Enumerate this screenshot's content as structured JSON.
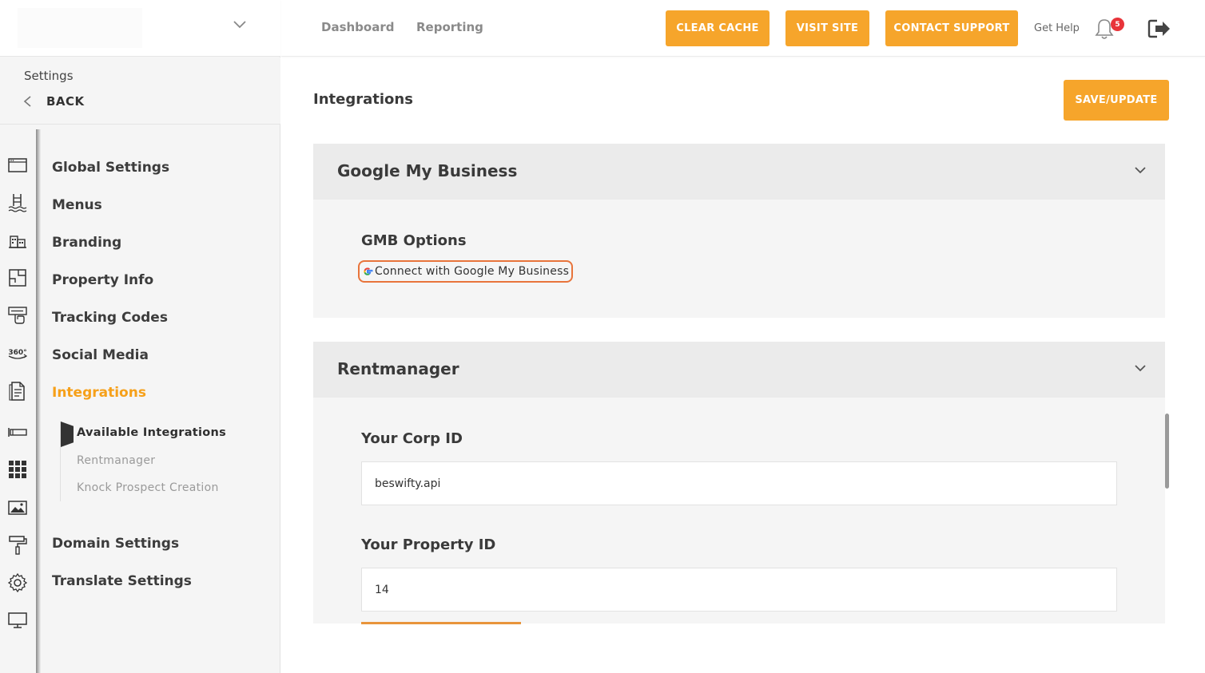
{
  "sidebar": {
    "settings_label": "Settings",
    "back_label": "BACK",
    "nav": [
      {
        "label": "Global Settings"
      },
      {
        "label": "Menus"
      },
      {
        "label": "Branding"
      },
      {
        "label": "Property Info"
      },
      {
        "label": "Tracking Codes"
      },
      {
        "label": "Social Media"
      },
      {
        "label": "Integrations"
      },
      {
        "label": "Domain Settings"
      },
      {
        "label": "Translate Settings"
      }
    ],
    "sub_nav": [
      {
        "label": "Available Integrations"
      },
      {
        "label": "Rentmanager"
      },
      {
        "label": "Knock Prospect Creation"
      }
    ],
    "rail_icons": [
      "browser-window-icon",
      "pool-icon",
      "buildings-icon",
      "floorplan-icon",
      "touch-sign-icon",
      "360-view-icon",
      "document-icon",
      "tag-icon",
      "grid-apps-icon",
      "image-gallery-icon",
      "paint-roller-icon",
      "gear-icon",
      "monitor-icon"
    ],
    "rail_badge_text": "360°"
  },
  "topbar": {
    "links": [
      "Dashboard",
      "Reporting"
    ],
    "clear_cache": "CLEAR CACHE",
    "visit_site": "VISIT SITE",
    "contact_support": "CONTACT SUPPORT",
    "get_help": "Get Help",
    "notification_count": "5"
  },
  "main": {
    "title": "Integrations",
    "save_label": "SAVE/UPDATE",
    "gmb": {
      "panel_title": "Google My Business",
      "options_title": "GMB Options",
      "connect_label": "Connect with Google My Business"
    },
    "rentmanager": {
      "panel_title": "Rentmanager",
      "corp_label": "Your Corp ID",
      "corp_value": "beswifty.api",
      "property_label": "Your Property ID",
      "property_value": "14"
    }
  },
  "colors": {
    "accent": "#f6a52b",
    "active_nav": "#f6a019",
    "highlight_border": "#e8743b",
    "badge": "#e8343a"
  }
}
